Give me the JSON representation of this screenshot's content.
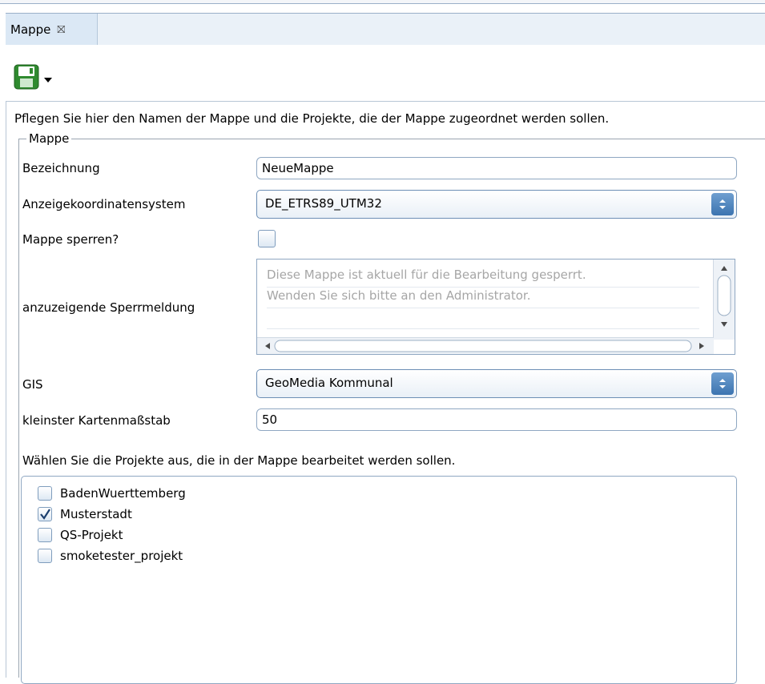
{
  "tab": {
    "label": "Mappe",
    "close_glyph": "⛝"
  },
  "toolbar": {
    "save_icon": "floppy-save-icon",
    "dropdown_icon": "chevron-down-icon"
  },
  "intro_text": "Pflegen Sie hier den Namen der Mappe und die Projekte, die der Mappe zugeordnet werden sollen.",
  "group_title": "Mappe",
  "form": {
    "bezeichnung": {
      "label": "Bezeichnung",
      "value": "NeueMappe"
    },
    "koordsystem": {
      "label": "Anzeigekoordinatensystem",
      "value": "DE_ETRS89_UTM32"
    },
    "sperren": {
      "label": "Mappe sperren?",
      "checked": false
    },
    "sperrmeldung": {
      "label": "anzuzeigende Sperrmeldung",
      "line1": "Diese Mappe ist aktuell für die Bearbeitung gesperrt.",
      "line2": "Wenden Sie sich bitte an den Administrator."
    },
    "gis": {
      "label": "GIS",
      "value": "GeoMedia Kommunal"
    },
    "massstab": {
      "label": "kleinster Kartenmaßstab",
      "value": "50"
    }
  },
  "projects": {
    "prompt": "Wählen Sie die Projekte aus, die in der Mappe bearbeitet werden sollen.",
    "items": [
      {
        "label": "BadenWuerttemberg",
        "checked": false
      },
      {
        "label": "Musterstadt",
        "checked": true
      },
      {
        "label": "QS-Projekt",
        "checked": false
      },
      {
        "label": "smoketester_projekt",
        "checked": false
      }
    ]
  },
  "colors": {
    "accent": "#3c74b0",
    "border": "#8fa7c2",
    "tab_bg": "#dbe8f5"
  }
}
